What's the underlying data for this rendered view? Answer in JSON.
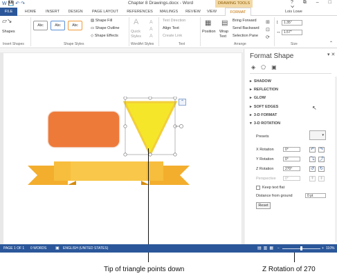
{
  "window": {
    "title": "Chapter 8 Drawings.docx - Word",
    "context_tab_title": "DRAWING TOOLS",
    "controls": [
      "?",
      "⧉",
      "–",
      "□",
      "✕"
    ]
  },
  "tabs": [
    "FILE",
    "HOME",
    "INSERT",
    "DESIGN",
    "PAGE LAYOUT",
    "REFERENCES",
    "MAILINGS",
    "REVIEW",
    "VIEW",
    "FORMAT"
  ],
  "user": "Lois Lowe",
  "ribbon": {
    "insert_shapes": {
      "label": "Insert Shapes",
      "shapes_label": "Shapes"
    },
    "shape_styles": {
      "label": "Shape Styles",
      "style_samples": [
        "Abc",
        "Abc",
        "Abc"
      ],
      "shape_fill": "Shape Fill",
      "shape_outline": "Shape Outline",
      "shape_effects": "Shape Effects"
    },
    "wordart_styles": {
      "label": "WordArt Styles",
      "quick_styles": "Quick Styles"
    },
    "text": {
      "label": "Text",
      "text_direction": "Text Direction",
      "align_text": "Align Text",
      "create_link": "Create Link"
    },
    "arrange": {
      "label": "Arrange",
      "position": "Position",
      "wrap_text": "Wrap Text",
      "bring_forward": "Bring Forward",
      "send_backward": "Send Backward",
      "selection_pane": "Selection Pane"
    },
    "size": {
      "label": "Size",
      "height": "1.35\"",
      "width": "1.57\""
    }
  },
  "pane": {
    "title": "Format Shape",
    "sections": [
      "SHADOW",
      "REFLECTION",
      "GLOW",
      "SOFT EDGES",
      "3-D FORMAT",
      "3-D ROTATION"
    ],
    "presets_label": "Presets",
    "x_rotation": {
      "label": "X Rotation",
      "value": "0°"
    },
    "y_rotation": {
      "label": "Y Rotation",
      "value": "0°"
    },
    "z_rotation": {
      "label": "Z Rotation",
      "value": "270°"
    },
    "perspective": {
      "label": "Perspective",
      "value": "0°"
    },
    "keep_text_flat": "Keep text flat",
    "distance_label": "Distance from ground",
    "distance_value": "0 pt",
    "reset": "Reset"
  },
  "statusbar": {
    "page": "PAGE 1 OF 1",
    "words": "0 WORDS",
    "language": "ENGLISH (UNITED STATES)",
    "zoom": "110%"
  },
  "captions": {
    "triangle": "Tip of triangle points down",
    "rotation": "Z Rotation of 270"
  },
  "colors": {
    "accent": "#2b579a",
    "orange_shape": "#ee7a3a",
    "triangle_fill": "#f5e62a",
    "banner": "#f5b534"
  }
}
